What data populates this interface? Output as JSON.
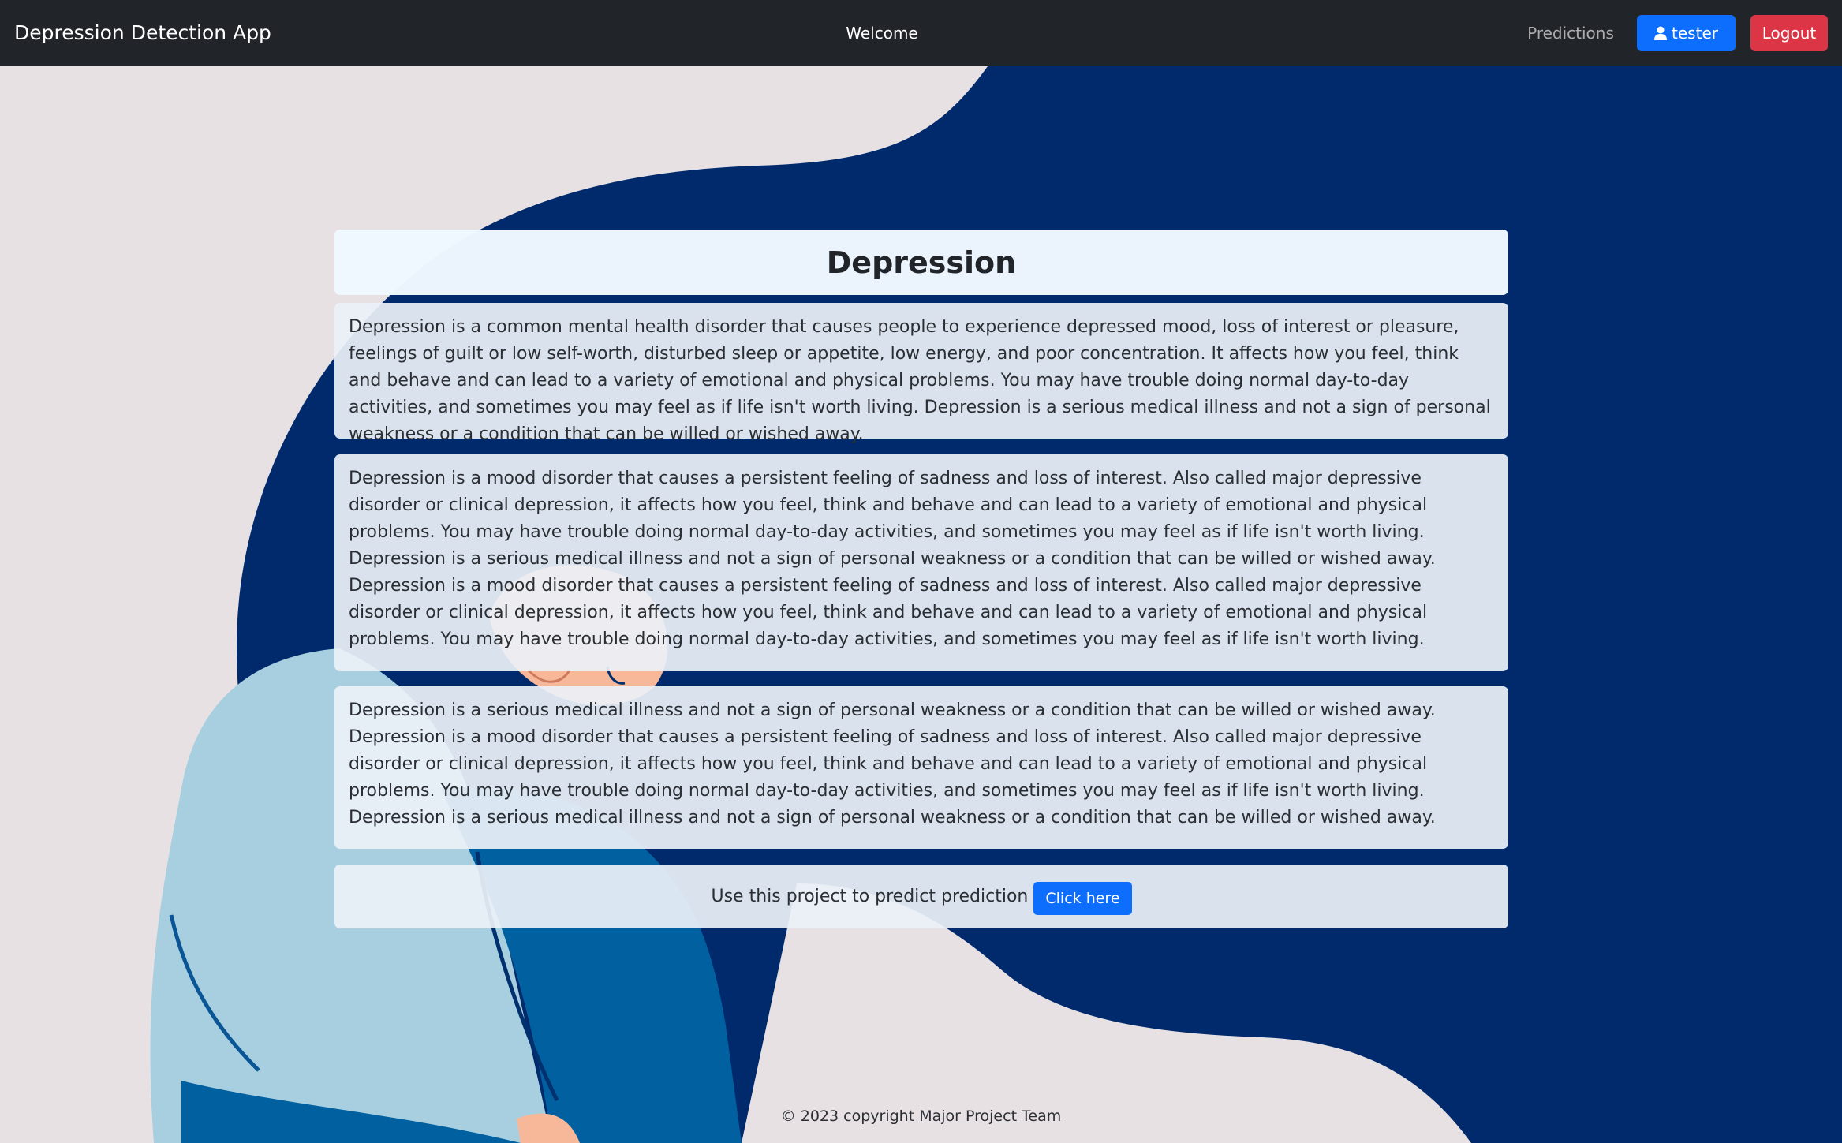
{
  "navbar": {
    "brand": "Depression Detection App",
    "welcome": "Welcome",
    "predictions_link": "Predictions",
    "user_button": "tester",
    "logout_button": "Logout"
  },
  "main": {
    "title": "Depression",
    "paragraphs": [
      "Depression is a common mental health disorder that causes people to experience depressed mood, loss of interest or pleasure, feelings of guilt or low self-worth, disturbed sleep or appetite, low energy, and poor concentration. It affects how you feel, think and behave and can lead to a variety of emotional and physical problems. You may have trouble doing normal day-to-day activities, and sometimes you may feel as if life isn't worth living. Depression is a serious medical illness and not a sign of personal weakness or a condition that can be willed or wished away.",
      "Depression is a mood disorder that causes a persistent feeling of sadness and loss of interest. Also called major depressive disorder or clinical depression, it affects how you feel, think and behave and can lead to a variety of emotional and physical problems. You may have trouble doing normal day-to-day activities, and sometimes you may feel as if life isn't worth living. Depression is a serious medical illness and not a sign of personal weakness or a condition that can be willed or wished away. Depression is a mood disorder that causes a persistent feeling of sadness and loss of interest. Also called major depressive disorder or clinical depression, it affects how you feel, think and behave and can lead to a variety of emotional and physical problems. You may have trouble doing normal day-to-day activities, and sometimes you may feel as if life isn't worth living.",
      "Depression is a serious medical illness and not a sign of personal weakness or a condition that can be willed or wished away. Depression is a mood disorder that causes a persistent feeling of sadness and loss of interest. Also called major depressive disorder or clinical depression, it affects how you feel, think and behave and can lead to a variety of emotional and physical problems. You may have trouble doing normal day-to-day activities, and sometimes you may feel as if life isn't worth living. Depression is a serious medical illness and not a sign of personal weakness or a condition that can be willed or wished away."
    ],
    "cta_text": "Use this project to predict prediction",
    "cta_button": "Click here"
  },
  "footer": {
    "text": "© 2023 copyright",
    "link": "Major Project Team"
  },
  "icons": {
    "user_icon": "person-icon"
  },
  "colors": {
    "navbar": "#212529",
    "primary": "#0d6efd",
    "danger": "#dc3545",
    "hair": "#002a6b",
    "background": "#e8e1e4"
  }
}
